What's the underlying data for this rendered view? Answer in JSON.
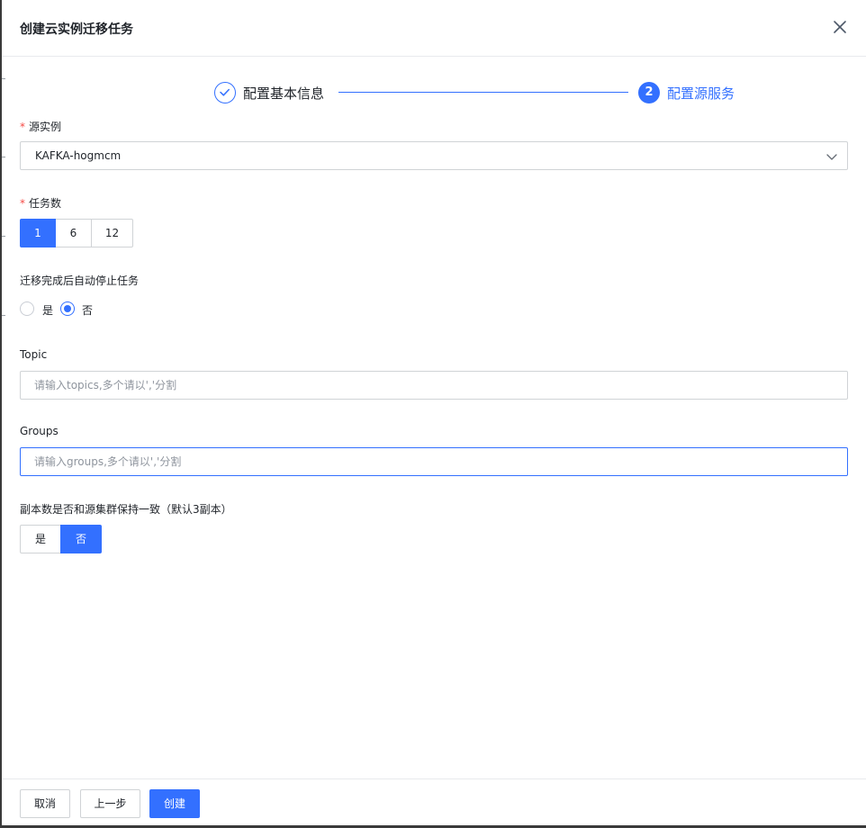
{
  "dialog": {
    "title": "创建云实例迁移任务"
  },
  "steps": [
    {
      "label": "配置基本信息",
      "status": "done",
      "icon": "check-icon"
    },
    {
      "label": "配置源服务",
      "status": "active",
      "number": "2"
    }
  ],
  "form": {
    "source_instance": {
      "label": "源实例",
      "required": true,
      "value": "KAFKA-hogmcm"
    },
    "task_count": {
      "label": "任务数",
      "required": true,
      "options": [
        "1",
        "6",
        "12"
      ],
      "selected": "1"
    },
    "auto_stop": {
      "label": "迁移完成后自动停止任务",
      "options": [
        "是",
        "否"
      ],
      "selected": "否"
    },
    "topic": {
      "label": "Topic",
      "value": "",
      "placeholder": "请输入topics,多个请以','分割"
    },
    "groups": {
      "label": "Groups",
      "value": "",
      "placeholder": "请输入groups,多个请以','分割"
    },
    "replica_consistency": {
      "label": "副本数是否和源集群保持一致（默认3副本）",
      "options": [
        "是",
        "否"
      ],
      "selected": "否"
    }
  },
  "footer": {
    "cancel_label": "取消",
    "prev_label": "上一步",
    "create_label": "创建"
  },
  "colors": {
    "primary": "#3370ff",
    "required": "#f54a45",
    "border": "#d0d3d6"
  }
}
